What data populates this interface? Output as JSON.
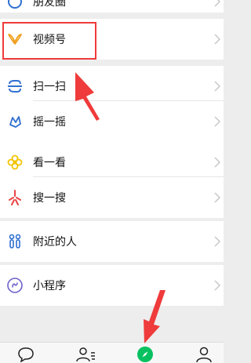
{
  "menu": {
    "moments_label": "朋友圈",
    "channels_label": "视频号",
    "scan_label": "扫一扫",
    "shake_label": "摇一摇",
    "top_stories_label": "看一看",
    "search_label": "搜一搜",
    "nearby_label": "附近的人",
    "mini_programs_label": "小程序"
  },
  "colors": {
    "background": "#ededed",
    "highlight": "#ef3b3b",
    "active_tab": "#07c160",
    "scan_icon": "#2f6fd0",
    "shake_icon": "#2f6fd0",
    "top_stories_icon": "#f3c400",
    "search_icon": "#e94444",
    "nearby_icon": "#2f6fd0",
    "mini_programs_icon": "#6d62c9",
    "channels_icon": "#f0a020"
  },
  "tabbar": {
    "items": [
      {
        "icon": "chat-bubble-icon"
      },
      {
        "icon": "contacts-icon"
      },
      {
        "icon": "discover-compass-icon",
        "active": true
      },
      {
        "icon": "me-person-icon"
      }
    ]
  }
}
